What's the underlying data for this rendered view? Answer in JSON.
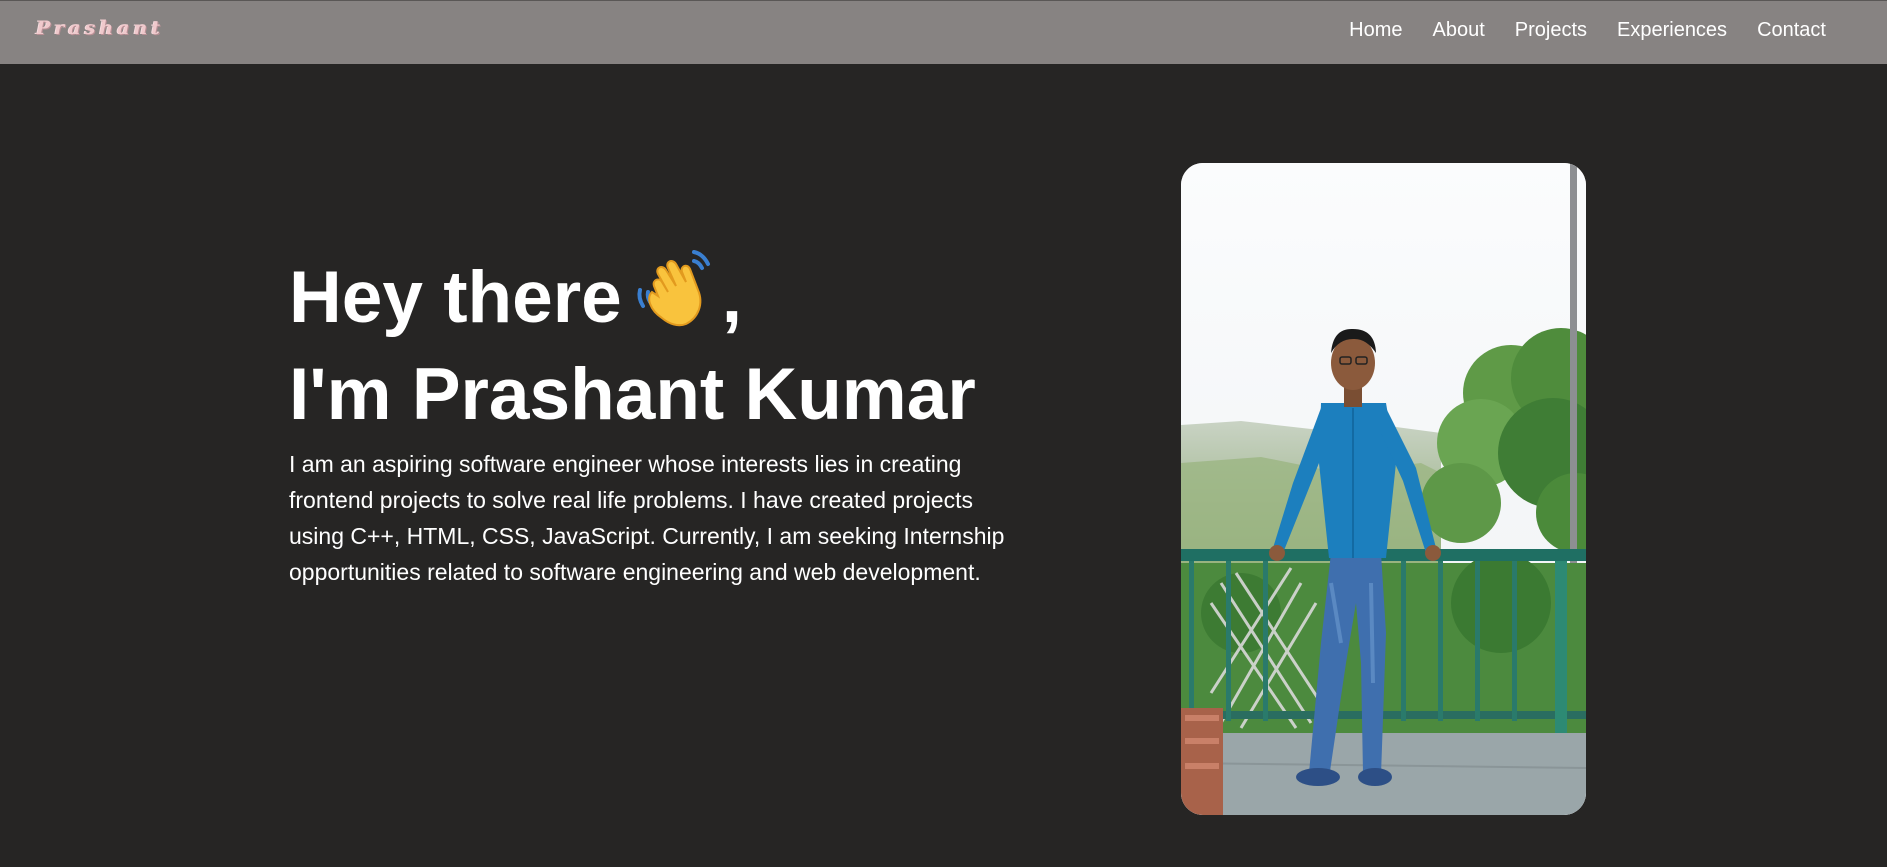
{
  "navbar": {
    "logo": "Prashant",
    "links": [
      {
        "label": "Home"
      },
      {
        "label": "About"
      },
      {
        "label": "Projects"
      },
      {
        "label": "Experiences"
      },
      {
        "label": "Contact"
      }
    ]
  },
  "hero": {
    "greeting": "Hey there",
    "greeting_suffix": ",",
    "greeting_icon": "waving-hand-icon",
    "name_line": "I'm Prashant Kumar",
    "bio": "I am an aspiring software engineer whose interests lies in creating frontend projects to solve real life problems. I have created projects using C++, HTML, CSS, JavaScript. Currently, I am seeking Internship opportunities related to software engineering and web development."
  },
  "colors": {
    "navbar_bg": "#878382",
    "page_bg": "#262524",
    "text": "#ffffff",
    "logo": "#efc9cc"
  }
}
